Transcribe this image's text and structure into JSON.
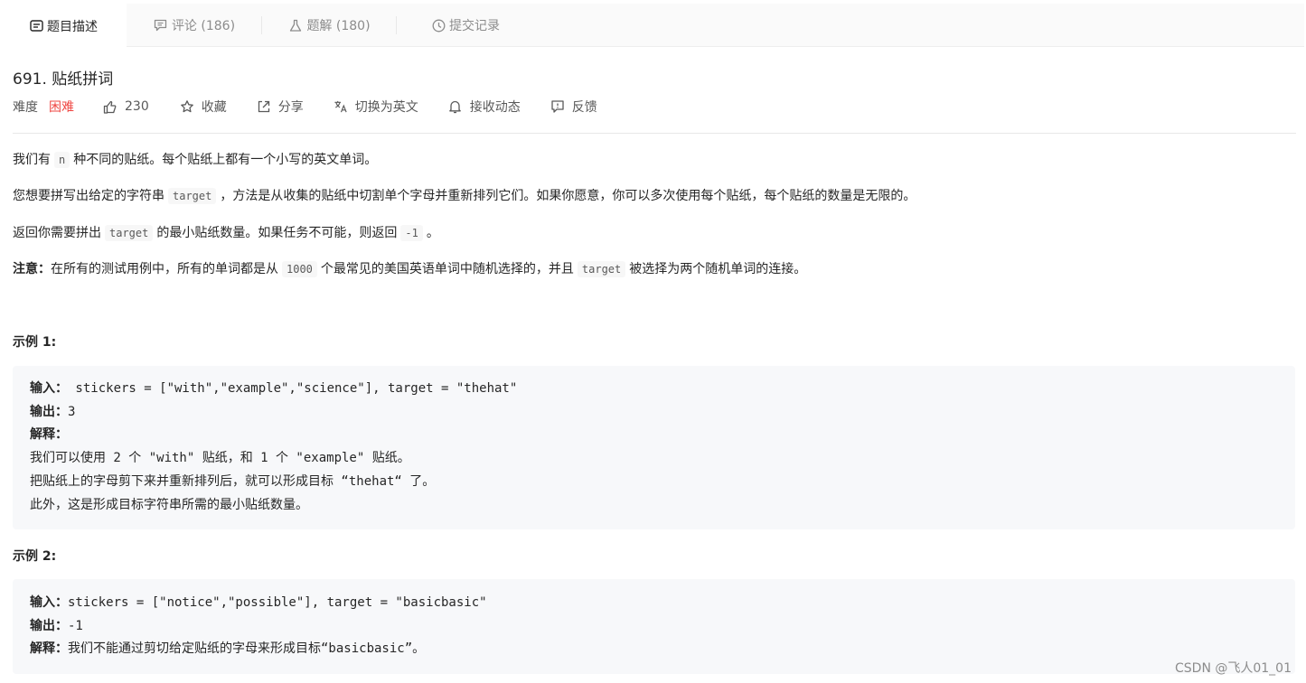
{
  "tabs": [
    {
      "label": "题目描述",
      "icon": "description-icon"
    },
    {
      "label": "评论 (186)",
      "icon": "comment-icon"
    },
    {
      "label": "题解 (180)",
      "icon": "flask-icon"
    },
    {
      "label": "提交记录",
      "icon": "clock-icon"
    }
  ],
  "problem": {
    "title": "691. 贴纸拼词",
    "difficulty_label": "难度",
    "difficulty": "困难",
    "likes": "230",
    "favorite": "收藏",
    "share": "分享",
    "switch_lang": "切换为英文",
    "notify": "接收动态",
    "feedback": "反馈"
  },
  "description": {
    "p1": {
      "a": "我们有",
      "code": "n",
      "b": "种不同的贴纸。每个贴纸上都有一个小写的英文单词。"
    },
    "p2": {
      "a": "您想要拼写出给定的字符串",
      "code": "target",
      "b": "，方法是从收集的贴纸中切割单个字母并重新排列它们。如果你愿意，你可以多次使用每个贴纸，每个贴纸的数量是无限的。"
    },
    "p3": {
      "a": "返回你需要拼出",
      "code": "target",
      "b": "的最小贴纸数量。如果任务不可能，则返回",
      "code2": "-1",
      "c": "。"
    },
    "p4": {
      "bold": "注意：",
      "a": "在所有的测试用例中，所有的单词都是从",
      "code": "1000",
      "b": "个最常见的美国英语单词中随机选择的，并且",
      "code2": "target",
      "c": "被选择为两个随机单词的连接。"
    }
  },
  "examples": [
    {
      "heading": "示例 1:",
      "input_label": "输入：",
      "input": " stickers = [\"with\",\"example\",\"science\"], target = \"thehat\"",
      "output_label": "输出：",
      "output": "3",
      "explain_label": "解释：",
      "explain_lines": [
        "我们可以使用 2 个 \"with\" 贴纸，和 1 个 \"example\" 贴纸。",
        "把贴纸上的字母剪下来并重新排列后，就可以形成目标 “thehat“ 了。",
        "此外，这是形成目标字符串所需的最小贴纸数量。"
      ]
    },
    {
      "heading": "示例 2:",
      "input_label": "输入：",
      "input": "stickers = [\"notice\",\"possible\"], target = \"basicbasic\"",
      "output_label": "输出：",
      "output": "-1",
      "explain_label": "解释：",
      "explain": "我们不能通过剪切给定贴纸的字母来形成目标“basicbasic”。"
    }
  ],
  "watermark": "CSDN @飞人01_01",
  "colors": {
    "hard": "#ef4743",
    "muted": "#8c8c8c",
    "code_bg": "#f7f8fa"
  }
}
